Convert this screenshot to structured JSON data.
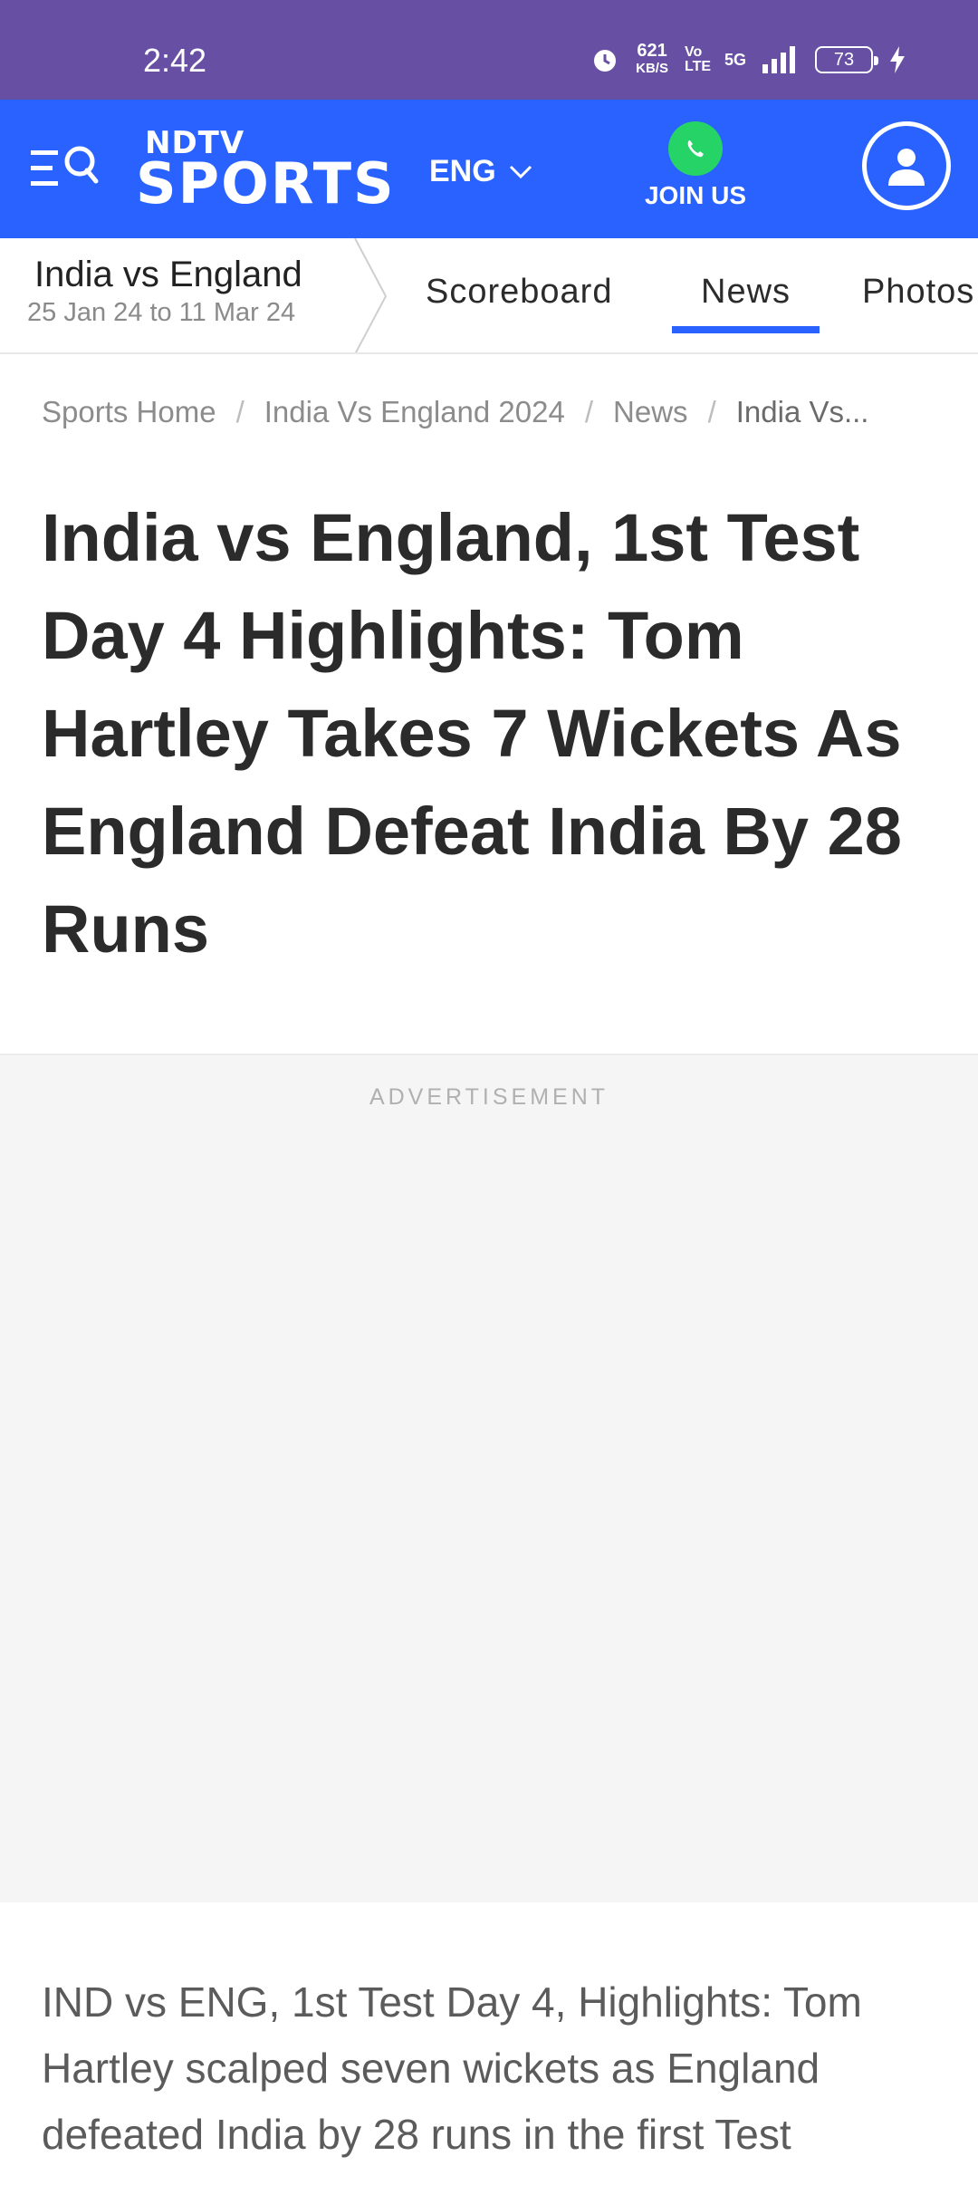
{
  "status_bar": {
    "time": "2:42",
    "net_speed_value": "621",
    "net_speed_unit": "KB/S",
    "volte": "Vo LTE",
    "network": "5G",
    "battery": "73"
  },
  "header": {
    "logo_top": "NDTV",
    "logo_bottom": "SPORTS",
    "language": "ENG",
    "join_label": "JOIN US",
    "brand_color": "#2962ff",
    "whatsapp_color": "#25d366"
  },
  "series": {
    "title": "India vs England",
    "dates": "25 Jan 24 to 11 Mar 24",
    "tabs": [
      {
        "label": "Scoreboard",
        "active": false
      },
      {
        "label": "News",
        "active": true
      },
      {
        "label": "Photos",
        "active": false
      }
    ]
  },
  "breadcrumb": [
    "Sports Home",
    "India Vs England 2024",
    "News",
    "India Vs..."
  ],
  "headline": "India vs England, 1st Test Day 4 Highlights: Tom Hartley Takes 7 Wickets As England Defeat India By 28 Runs",
  "ad": {
    "label": "ADVERTISEMENT"
  },
  "summary": "IND vs ENG, 1st Test Day 4, Highlights: Tom Hartley scalped seven wickets as England defeated India by 28 runs in the first Test"
}
